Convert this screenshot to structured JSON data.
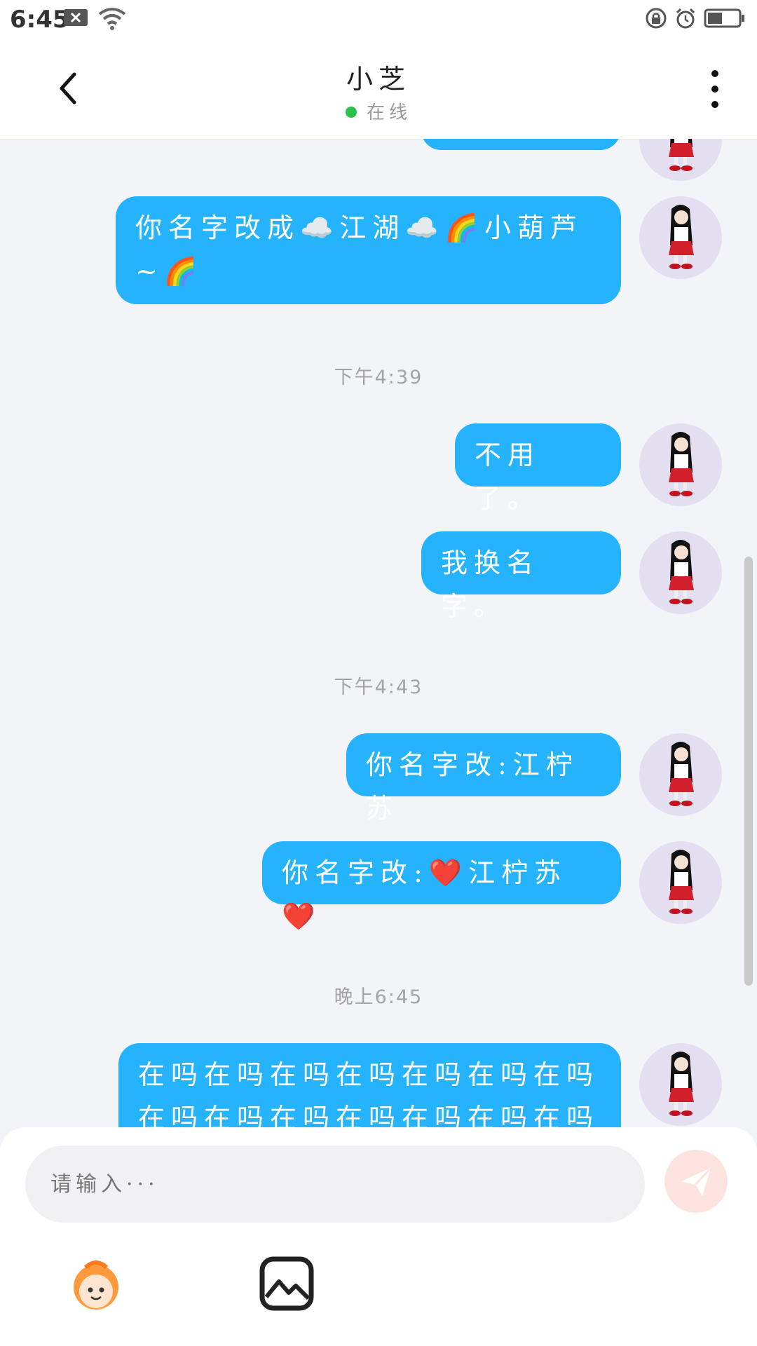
{
  "status_bar": {
    "time": "6:45"
  },
  "header": {
    "title": "小芝",
    "status": "在线"
  },
  "messages": {
    "m1": "你名字改成☁️江湖☁️🌈小葫芦~🌈",
    "t1": "下午4:39",
    "m2": "不用了。",
    "m3": "我换名字。",
    "t2": "下午4:43",
    "m4": "你名字改:江柠苏",
    "m5": "你名字改:❤️江柠苏❤️",
    "t3": "晚上6:45",
    "m6": "在吗在吗在吗在吗在吗在吗在吗在吗在吗在吗在吗在吗在吗在吗"
  },
  "composer": {
    "placeholder": "请输入···"
  },
  "colors": {
    "bubble": "#24b3fc",
    "online": "#2bc24a",
    "send": "#fde3df"
  },
  "icons": [
    "back-arrow-icon",
    "more-vertical-icon",
    "send-plane-icon",
    "emoji-face-icon",
    "image-picker-icon"
  ]
}
